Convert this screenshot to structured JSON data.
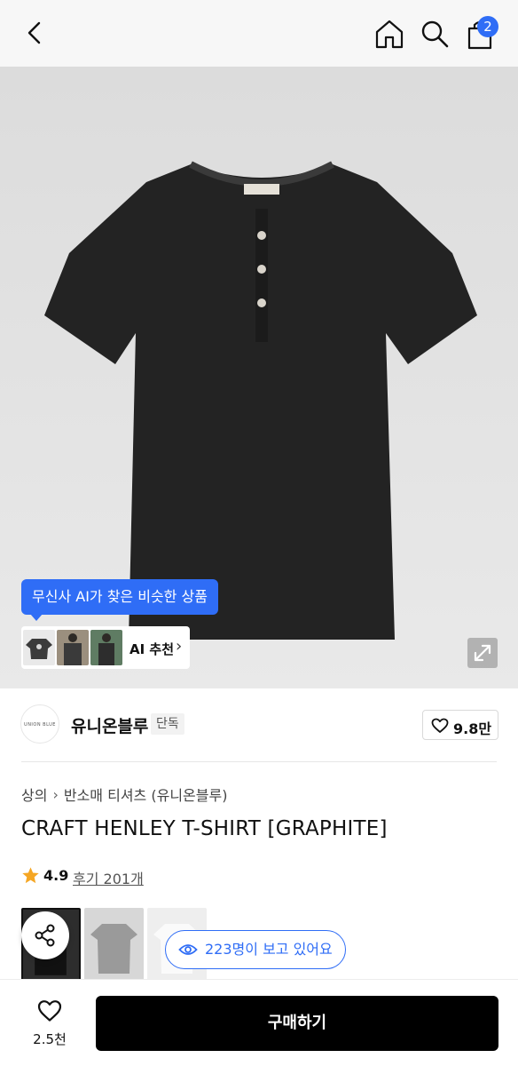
{
  "nav": {
    "cart_count": "2"
  },
  "ai": {
    "tooltip": "무신사 AI가 찾은 비슷한 상품",
    "label": "AI 추천",
    "chevron": "›"
  },
  "brand": {
    "logo_text": "UNION BLUE",
    "name": "유니온블루",
    "badge": "단독",
    "likes": "9.8만"
  },
  "breadcrumb": {
    "category": "상의",
    "separator": "›",
    "subcategory": "반소매 티셔츠 (유니온블루)"
  },
  "product": {
    "title": "CRAFT HENLEY T-SHIRT [GRAPHITE]",
    "rating": "4.9",
    "reviews": "후기 201개"
  },
  "viewers": "223명이 보고 있어요",
  "bottom": {
    "wish_count": "2.5천",
    "buy_label": "구매하기"
  },
  "colors": {
    "accent": "#2f6df6",
    "star": "#f5a623",
    "button": "#000000"
  },
  "icons": [
    "back-icon",
    "home-icon",
    "search-icon",
    "cart-icon",
    "heart-icon",
    "star-icon",
    "share-icon",
    "eye-icon",
    "expand-icon"
  ]
}
